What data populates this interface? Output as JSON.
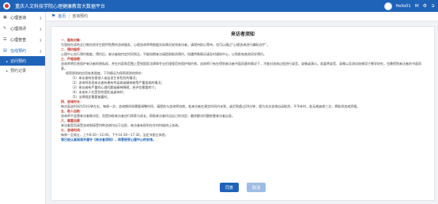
{
  "header": {
    "title": "重庆人文科技学院心理健康教育大数据平台",
    "user_name": "Hello01",
    "icons": [
      "user-avatar",
      "notification-icon",
      "settings-icon",
      "logout-icon"
    ]
  },
  "sidebar": {
    "items": [
      {
        "label": "心理咨询",
        "icon": "menu-icon"
      },
      {
        "label": "心理测评",
        "icon": "menu-icon"
      },
      {
        "label": "心理普查",
        "icon": "menu-icon"
      },
      {
        "label": "在线预约",
        "icon": "menu-icon",
        "open": true,
        "children": [
          {
            "label": "访问预约",
            "active": true
          },
          {
            "label": "预约记录",
            "active": false
          }
        ]
      }
    ]
  },
  "breadcrumb": {
    "home": "首页",
    "current": "咨询预约"
  },
  "notice": {
    "title": "来访者须知",
    "lines": [
      {
        "t": "一、服务对象：",
        "c": "h"
      },
      {
        "t": "为我校在读的全日制在校学生提供免费的咨询服务，心理咨询师将根据实际情况安排来访者，请保持耐心等待，也可以通过“心理咨询进行辅助治疗”。",
        "c": ""
      },
      {
        "t": "二、预约程序：",
        "c": "h"
      },
      {
        "t": "心理中心实行预约制度，预约后，来访者按约定时间到达，不能如期来访请提前取消预约，如遇特殊情况请及时通知中心，以免影响其他同学预约。",
        "c": ""
      },
      {
        "t": "三、严格保密：",
        "c": "h"
      },
      {
        "t": "咨询师将负责保护来访者的隐私权，并在内容和范围上受到国家法律和专业伦理规范的保护和约束，咨询师只有在得到来访者书面同意的情况下，才能对咨询过程进行录音、录像或演示。若要将录音、录像以及测试结果用于教学研究，也需得到来访者的书面同意。",
        "c": "wrap"
      },
      {
        "t": "保密原则的应用有其限度，下列情况为保密原则的例外：",
        "c": "ind"
      },
      {
        "t": "（1）来访者有伤害他人或自身生命危险的情况；",
        "c": "ind2"
      },
      {
        "t": "（2）咨询师发现来访者有患有传染病或精神病等严重疾病的情况；",
        "c": "ind2"
      },
      {
        "t": "（3）来访者有严重的心理问题或精神障碍，经评估需要转介；",
        "c": "ind2"
      },
      {
        "t": "（4）未成年人在受到性侵犯或虐待时；",
        "c": "ind2"
      },
      {
        "t": "（5）法律规定需要披露时。",
        "c": "ind2"
      },
      {
        "t": "四、咨询时长：",
        "c": "h"
      },
      {
        "t": "每次面谈时间为50分钟左右，每周一次，咨询期间如需要调整时间，请提前与咨询师协商，若来访者在规定时间内未到，或迟到超过20分钟，视为本次咨询自动取消，不予补时，若无故缺席三次，将取消咨询资格。",
        "c": "wrap"
      },
      {
        "t": "五、助人自助：",
        "c": "h"
      },
      {
        "t": "咨询师不会替来访者做决定，而是协助来访者进行探索与成长，帮助来访者作出自己的决定，最终解决问题依靠来访者自身。",
        "c": ""
      },
      {
        "t": "六、尊重自愿：",
        "c": "h"
      },
      {
        "t": "来访者是否接受咨询和接受何种咨询均出于自愿，来访者有权利在任何时候终止咨询。",
        "c": ""
      },
      {
        "t": "七、咨询时间：",
        "c": "h"
      },
      {
        "t": "每周一至周五，上午8:30—12:00，下午14:30—17:30，法定节假日休息。",
        "c": ""
      },
      {
        "t": "我已经认真阅读并遵守《来访者须知》，同意接受心理中心的安排。",
        "c": "hl"
      }
    ]
  },
  "buttons": {
    "confirm": "同意",
    "cancel": "取消"
  }
}
